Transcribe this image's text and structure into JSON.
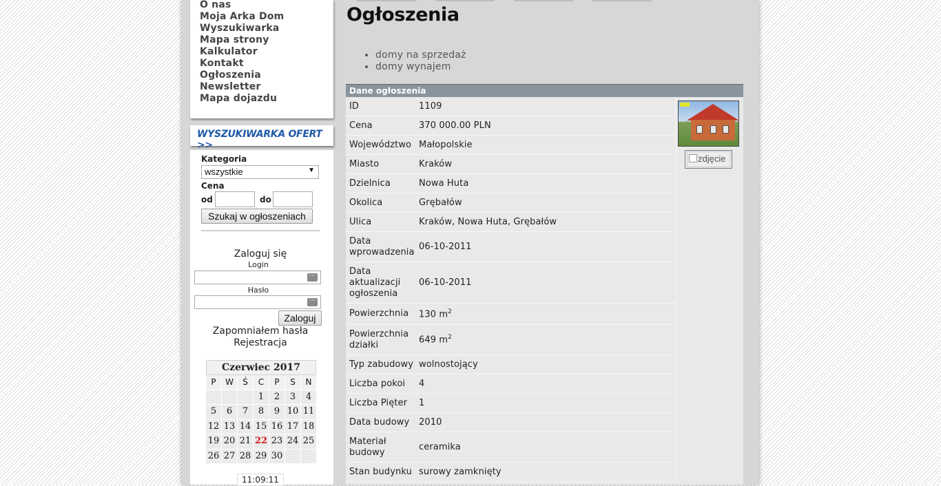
{
  "nav": {
    "items": [
      "O nas",
      "Moja Arka Dom",
      "Wyszukiwarka",
      "Mapa strony",
      "Kalkulator",
      "Kontakt",
      "Ogłoszenia",
      "Newsletter",
      "Mapa dojazdu"
    ]
  },
  "banner": {
    "label": "WYSZUKIWARKA OFERT >>"
  },
  "search": {
    "category_label": "Kategoria",
    "category_value": "wszystkie",
    "price_label": "Cena",
    "from_label": "od",
    "to_label": "do",
    "submit_label": "Szukaj w ogłoszeniach"
  },
  "login": {
    "title": "Zaloguj się",
    "login_label": "Login",
    "password_label": "Hasło",
    "submit_label": "Zaloguj",
    "forgot_link": "Zapomniałem hasła",
    "register_link": "Rejestracja"
  },
  "calendar": {
    "title": "Czerwiec 2017",
    "weekdays": [
      "P",
      "W",
      "Ś",
      "C",
      "P",
      "S",
      "N"
    ],
    "weeks": [
      [
        "",
        "",
        "",
        "1",
        "2",
        "3",
        "4"
      ],
      [
        "5",
        "6",
        "7",
        "8",
        "9",
        "10",
        "11"
      ],
      [
        "12",
        "13",
        "14",
        "15",
        "16",
        "17",
        "18"
      ],
      [
        "19",
        "20",
        "21",
        "22",
        "23",
        "24",
        "25"
      ],
      [
        "26",
        "27",
        "28",
        "29",
        "30",
        "",
        ""
      ]
    ],
    "today": "22"
  },
  "clock": "11:09:11",
  "main": {
    "title": "Ogłoszenia",
    "links": [
      "domy na sprzedaż",
      "domy wynajem"
    ],
    "panel_header": "Dane ogłoszenia",
    "image_alt": "zdjęcie",
    "fields": [
      {
        "label": "ID",
        "value": "1109"
      },
      {
        "label": "Cena",
        "value": "370 000.00 PLN"
      },
      {
        "label": "Województwo",
        "value": "Małopolskie"
      },
      {
        "label": "Miasto",
        "value": "Kraków"
      },
      {
        "label": "Dzielnica",
        "value": "Nowa Huta"
      },
      {
        "label": "Okolica",
        "value": "Grębałów"
      },
      {
        "label": "Ulica",
        "value": "Kraków, Nowa Huta, Grębałów"
      },
      {
        "label": "Data wprowadzenia",
        "value": "06-10-2011"
      },
      {
        "label": "Data aktualizacji ogłoszenia",
        "value": "06-10-2011"
      },
      {
        "label": "Powierzchnia",
        "value": "130 m",
        "unit_sup": "2"
      },
      {
        "label": "Powierzchnia działki",
        "value": "649 m",
        "unit_sup": "2"
      },
      {
        "label": "Typ zabudowy",
        "value": "wolnostojący"
      },
      {
        "label": "Liczba pokoi",
        "value": "4"
      },
      {
        "label": "Liczba Pięter",
        "value": "1"
      },
      {
        "label": "Data budowy",
        "value": "2010"
      },
      {
        "label": "Materiał budowy",
        "value": "ceramika"
      },
      {
        "label": "Stan budynku",
        "value": "surowy zamknięty"
      }
    ]
  }
}
